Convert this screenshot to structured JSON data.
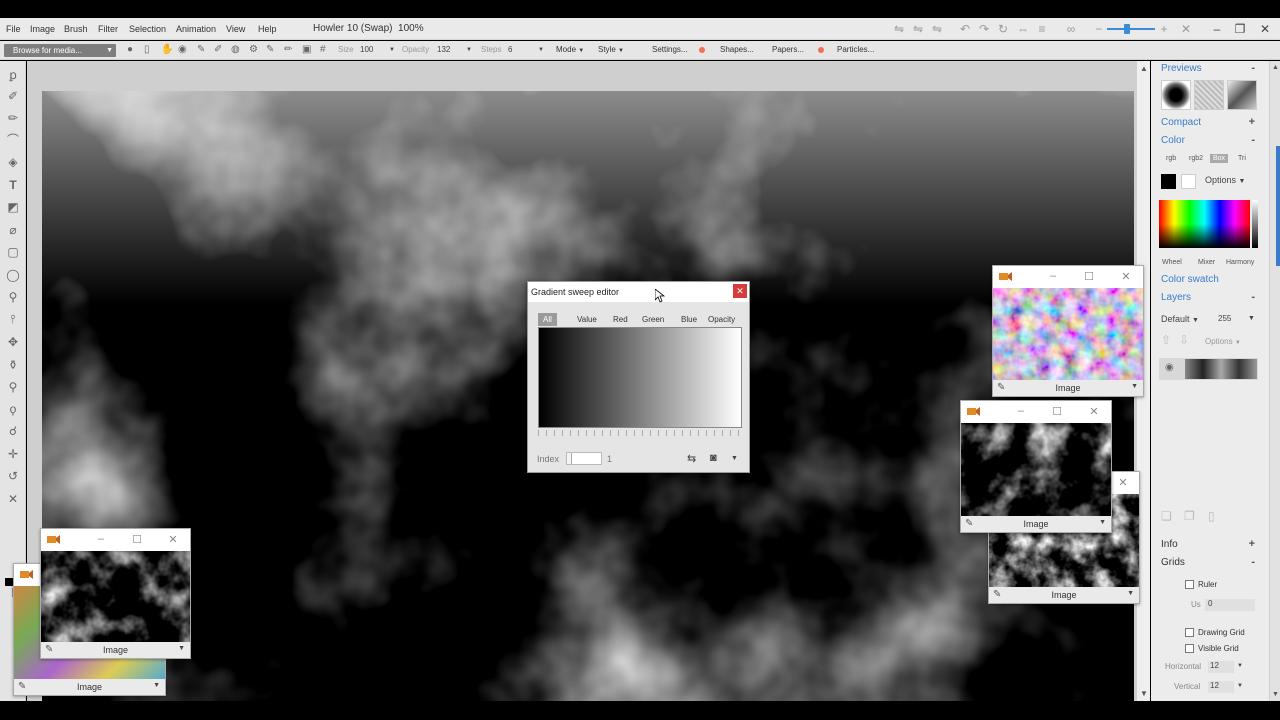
{
  "app": {
    "title": "Howler 10 (Swap)",
    "zoom": "100%"
  },
  "menus": [
    "File",
    "Image",
    "Brush",
    "Filter",
    "Selection",
    "Animation",
    "View",
    "Help"
  ],
  "options": {
    "browse": "Browse for media...",
    "size_label": "Size",
    "size_value": "100",
    "opacity_label": "Opacity",
    "opacity_value": "132",
    "steps_label": "Steps",
    "steps_value": "6",
    "mode": "Mode",
    "style": "Style",
    "settings": "Settings...",
    "shapes": "Shapes...",
    "papers": "Papers...",
    "particles": "Particles..."
  },
  "right_panel": {
    "previews": "Previews",
    "compact": "Compact",
    "color": "Color",
    "color_tabs": [
      "rgb",
      "rgb2",
      "Box",
      "Tri"
    ],
    "options": "Options",
    "picker_tabs": [
      "Wheel",
      "Mixer",
      "Harmony"
    ],
    "color_swatch": "Color swatch",
    "layers": "Layers",
    "blend_mode": "Default",
    "layer_opacity": "255",
    "layer_options": "Options",
    "info": "Info",
    "grids": "Grids",
    "ruler": "Ruler",
    "us_label": "Us",
    "us_value": "0",
    "drawing_grid": "Drawing Grid",
    "visible_grid": "Visible Grid",
    "horizontal_label": "Horizontal",
    "horizontal_value": "12",
    "vertical_label": "Vertical",
    "vertical_value": "12"
  },
  "windows": {
    "image_label": "Image"
  },
  "gradient_dialog": {
    "title": "Gradient sweep editor",
    "tabs": [
      "All",
      "Value",
      "Red",
      "Green",
      "Blue",
      "Opacity"
    ],
    "active_tab": "All",
    "index_label": "Index",
    "index_value": "1"
  },
  "icons": {
    "tools": [
      "brush-icon",
      "airbrush-icon",
      "pencil-icon",
      "curve-icon",
      "fill-icon",
      "text-icon",
      "transform-icon",
      "pen-icon",
      "rect-select-icon",
      "ellipse-select-icon",
      "magnifier-icon",
      "pin-icon",
      "move-icon",
      "dropper-icon",
      "stamp-icon",
      "lasso-icon",
      "smudge-icon",
      "crosshair-icon",
      "undo-icon",
      "wand-icon"
    ],
    "foreground": "#000000",
    "background": "#ffffff"
  },
  "colors": {
    "accent": "#3a7bc8",
    "close_red": "#d63c3c",
    "notice_orange": "#f07050"
  }
}
